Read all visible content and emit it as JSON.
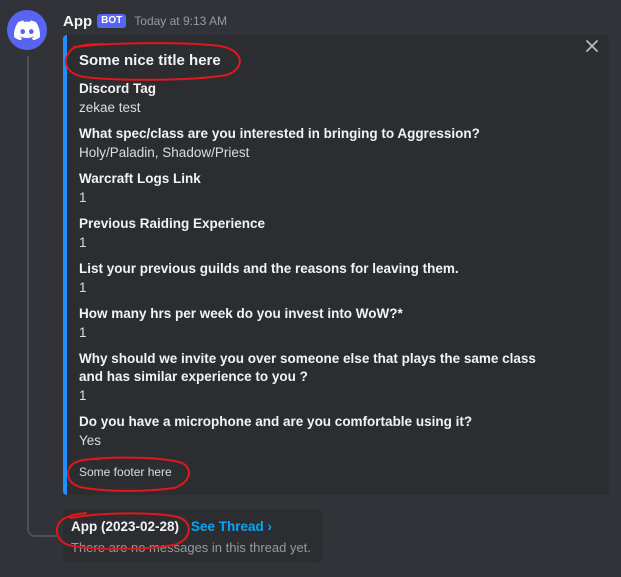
{
  "message": {
    "username": "App",
    "bot_tag": "BOT",
    "timestamp": "Today at 9:13 AM",
    "avatar_icon": "discord-logo-icon"
  },
  "embed": {
    "accent_color": "#1e90ff",
    "title": "Some nice title here",
    "fields": [
      {
        "name": "Discord Tag",
        "value": "zekae test"
      },
      {
        "name": "What spec/class are you interested in bringing to Aggression?",
        "value": "Holy/Paladin, Shadow/Priest"
      },
      {
        "name": "Warcraft Logs Link",
        "value": "1"
      },
      {
        "name": "Previous Raiding Experience",
        "value": "1"
      },
      {
        "name": "List your previous guilds and the reasons for leaving them.",
        "value": "1"
      },
      {
        "name": "How many hrs per week do you invest into WoW?*",
        "value": "1"
      },
      {
        "name": "Why should we invite you over someone else that plays the same class and has similar experience to you ?",
        "value": "1"
      },
      {
        "name": "Do you have a microphone and are you comfortable using it?",
        "value": "Yes"
      }
    ],
    "footer": "Some footer here",
    "close_icon": "close-icon"
  },
  "thread": {
    "name": "App (2023-02-28)",
    "link_label": "See Thread ›",
    "empty_text": "There are no messages in this thread yet."
  },
  "colors": {
    "background": "#313338",
    "embed_background": "#2b2d31",
    "blurple": "#5865f2",
    "link": "#00a8fc",
    "annotation": "#e0181b"
  }
}
